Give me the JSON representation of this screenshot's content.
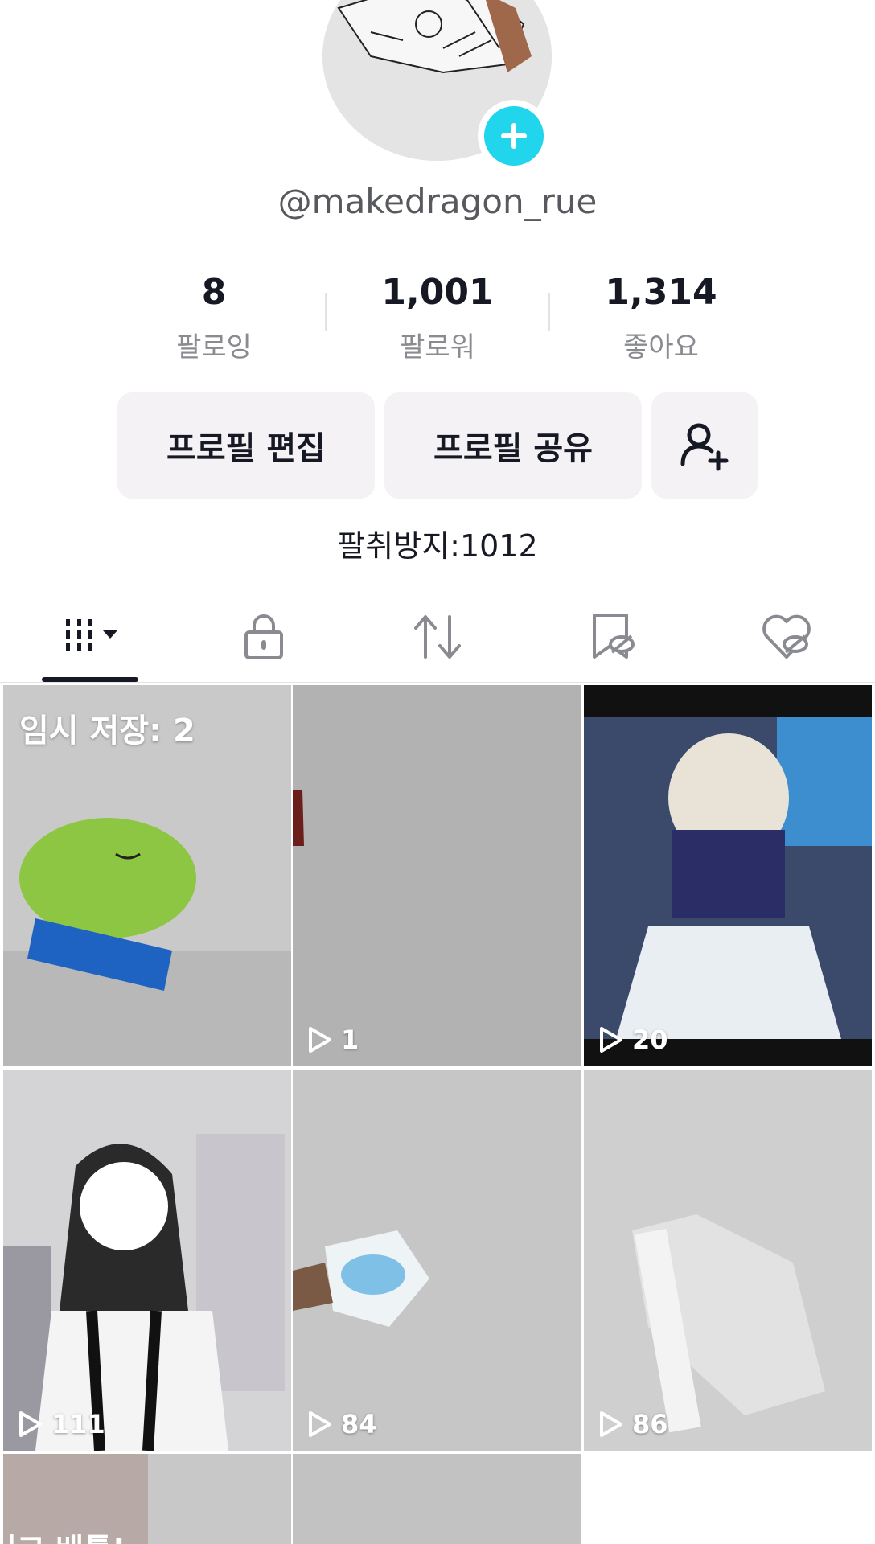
{
  "profile": {
    "username": "@makedragon_rue",
    "bio": "팔취방지:1012"
  },
  "stats": [
    {
      "value": "8",
      "label": "팔로잉"
    },
    {
      "value": "1,001",
      "label": "팔로워"
    },
    {
      "value": "1,314",
      "label": "좋아요"
    }
  ],
  "actions": {
    "edit_profile": "프로필 편집",
    "share_profile": "프로필 공유"
  },
  "tabs": [
    "videos-grid-icon",
    "lock-icon",
    "repost-icon",
    "bookmark-hidden-icon",
    "liked-hidden-icon"
  ],
  "grid": {
    "draft_label": "임시 저장: 2",
    "views": [
      "1",
      "20",
      "111",
      "84",
      "86"
    ],
    "partial_text": "니고 배틀!"
  },
  "colors": {
    "accent": "#20d5ec",
    "button_bg": "#f4f2f4",
    "text": "#161823",
    "muted": "#8a8b91"
  }
}
